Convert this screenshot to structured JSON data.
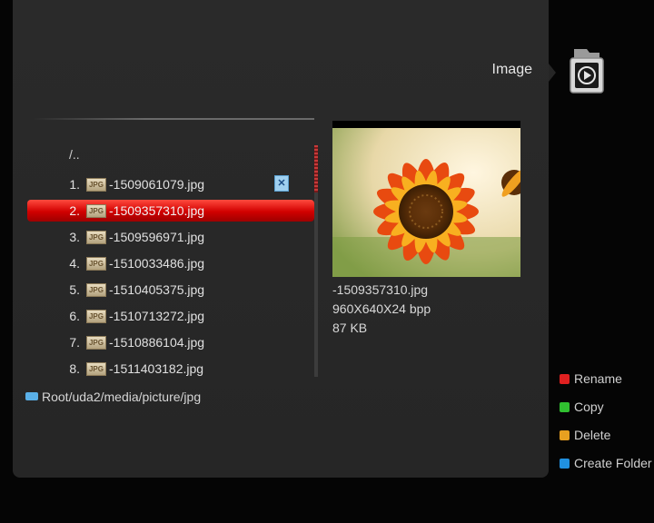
{
  "header": {
    "section_title": "Image",
    "section_icon": "folder-play-icon"
  },
  "file_list": {
    "parent_dir": "/..",
    "badge_label": "JPG",
    "items": [
      {
        "num": "1.",
        "name": "-1509061079.jpg",
        "checked": true
      },
      {
        "num": "2.",
        "name": "-1509357310.jpg",
        "selected": true
      },
      {
        "num": "3.",
        "name": "-1509596971.jpg"
      },
      {
        "num": "4.",
        "name": "-1510033486.jpg"
      },
      {
        "num": "5.",
        "name": "-1510405375.jpg"
      },
      {
        "num": "6.",
        "name": "-1510713272.jpg"
      },
      {
        "num": "7.",
        "name": "-1510886104.jpg"
      },
      {
        "num": "8.",
        "name": "-1511403182.jpg"
      }
    ],
    "check_icon": "check-x-icon"
  },
  "path": {
    "text": "Root/uda2/media/picture/jpg",
    "icon": "usb-drive-icon"
  },
  "preview": {
    "filename": "-1509357310.jpg",
    "dimensions": "960X640X24 bpp",
    "size": "87 KB"
  },
  "color_keys": [
    {
      "label": "Rename",
      "color": "#e02020"
    },
    {
      "label": "Copy",
      "color": "#30c030"
    },
    {
      "label": "Delete",
      "color": "#e8a020"
    },
    {
      "label": "Create Folder",
      "color": "#2090e0"
    }
  ]
}
